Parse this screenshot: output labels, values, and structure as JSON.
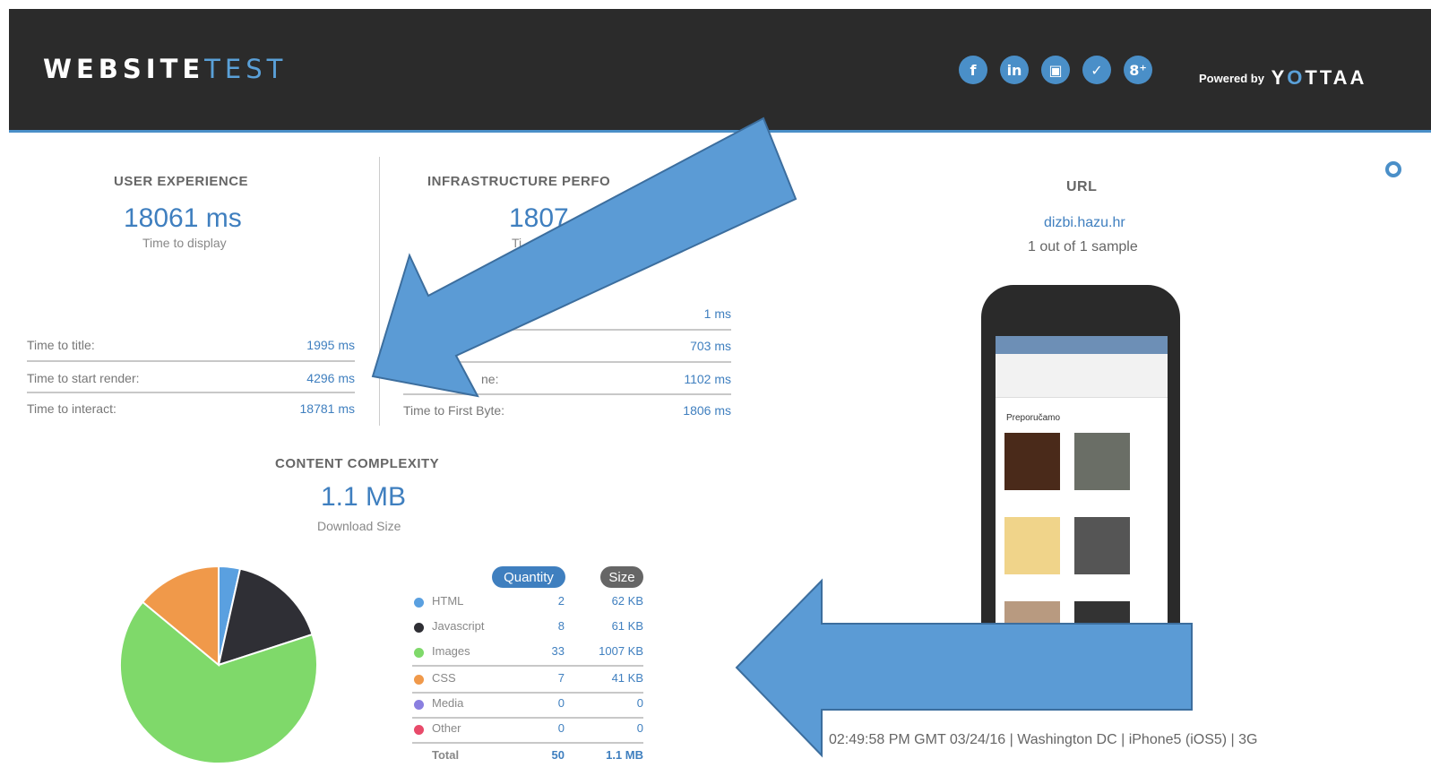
{
  "header": {
    "brand_main": "WEBSITE",
    "brand_accent": "TEST",
    "social": [
      {
        "icon": "facebook-icon",
        "glyph": "f"
      },
      {
        "icon": "linkedin-icon",
        "glyph": "in"
      },
      {
        "icon": "youtube-icon",
        "glyph": "▣"
      },
      {
        "icon": "twitter-icon",
        "glyph": "✓"
      },
      {
        "icon": "google-plus-icon",
        "glyph": "8⁺"
      }
    ],
    "powered_by": "Powered by",
    "powered_logo_a": "Y",
    "powered_logo_o": "O",
    "powered_logo_b": "TTAA"
  },
  "user_experience": {
    "title": "USER EXPERIENCE",
    "value": "18061 ms",
    "caption": "Time to display",
    "rows": [
      {
        "label": "Time to title:",
        "value": "1995 ms"
      },
      {
        "label": "Time to start render:",
        "value": "4296 ms"
      },
      {
        "label": "Time to interact:",
        "value": "18781 ms"
      }
    ]
  },
  "infrastructure": {
    "title": "INFRASTRUCTURE PERFO",
    "value": "1807",
    "caption": "Ti",
    "rows": [
      {
        "label": "",
        "value": "1 ms"
      },
      {
        "label": "",
        "value": "703 ms"
      },
      {
        "label": "ne:",
        "value": "1102 ms"
      },
      {
        "label": "Time to First Byte:",
        "value": "1806 ms"
      }
    ]
  },
  "url_panel": {
    "title": "URL",
    "url": "dizbi.hazu.hr",
    "sample": "1 out of 1 sample",
    "screen_heading": "Preporučamo"
  },
  "content": {
    "title": "CONTENT COMPLEXITY",
    "value": "1.1 MB",
    "caption": "Download Size",
    "head_quantity": "Quantity",
    "head_size": "Size",
    "rows": [
      {
        "name": "HTML",
        "qty": "2",
        "size": "62 KB",
        "color": "#5aa0e0"
      },
      {
        "name": "Javascript",
        "qty": "8",
        "size": "61 KB",
        "color": "#2f2f35"
      },
      {
        "name": "Images",
        "qty": "33",
        "size": "1007 KB",
        "color": "#7fd96a"
      },
      {
        "name": "CSS",
        "qty": "7",
        "size": "41 KB",
        "color": "#f0994a"
      },
      {
        "name": "Media",
        "qty": "0",
        "size": "0",
        "color": "#8a7fe0"
      },
      {
        "name": "Other",
        "qty": "0",
        "size": "0",
        "color": "#e84a6a"
      }
    ],
    "total_label": "Total",
    "total_qty": "50",
    "total_size": "1.1 MB"
  },
  "pie": [
    {
      "name": "HTML",
      "fraction": 0.035,
      "color": "#5aa0e0"
    },
    {
      "name": "Javascript",
      "fraction": 0.165,
      "color": "#2f2f35"
    },
    {
      "name": "Images",
      "fraction": 0.66,
      "color": "#7fd96a"
    },
    {
      "name": "CSS",
      "fraction": 0.14,
      "color": "#f0994a"
    }
  ],
  "footer_info": "02:49:58 PM GMT 03/24/16 | Washington DC | iPhone5 (iOS5) | 3G",
  "annotation_color": "#5b9bd5"
}
